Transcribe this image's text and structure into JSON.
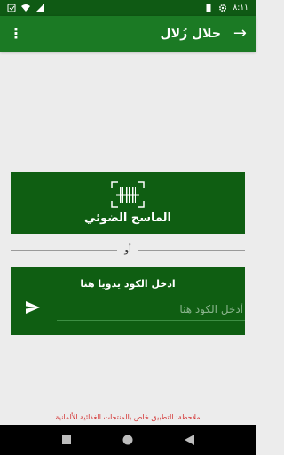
{
  "status_bar": {
    "time": "٨:١١"
  },
  "app_bar": {
    "title": "حلال زُلال",
    "back_icon": "arrow-right-icon",
    "menu_icon": "more-vertical-icon"
  },
  "scanner": {
    "label": "الماسح الضوئي",
    "icon": "barcode-scan-icon"
  },
  "divider": {
    "or_text": "أو"
  },
  "manual": {
    "title": "ادخل الكود يدويا هنا",
    "input_placeholder": "أدخل الكود هنا",
    "input_value": "",
    "send_icon": "send-icon"
  },
  "note": {
    "text": "ملاحظة: التطبيق خاص بالمنتجات الغذائية الألمانية"
  },
  "colors": {
    "status_bar": "#0f5a14",
    "app_bar": "#1b7a24",
    "card": "#0f5e12",
    "background": "#ececec",
    "note": "#d32f2f"
  }
}
